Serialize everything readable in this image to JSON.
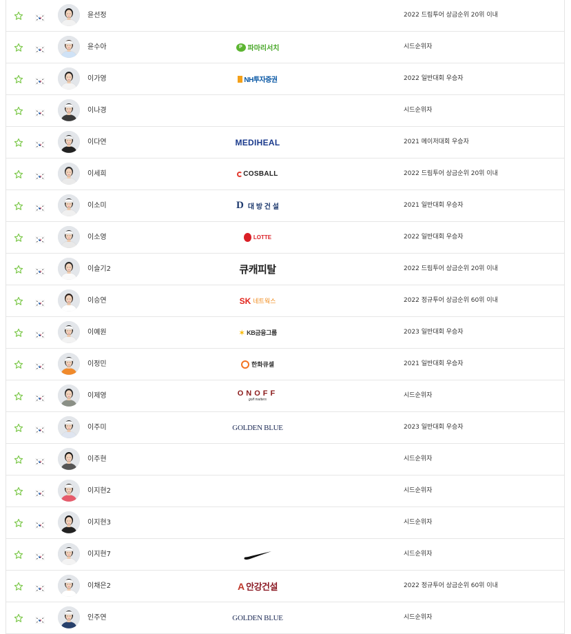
{
  "colors": {
    "star_outline": "#7cc84a",
    "border": "#e6e6e6",
    "text": "#333333"
  },
  "players": [
    {
      "name": "윤선정",
      "sponsor": null,
      "qualification": "2022 드림투어 상금순위 20위 이내"
    },
    {
      "name": "윤수아",
      "sponsor": {
        "kind": "pamarisc",
        "text": "파마리서치"
      },
      "qualification": "시드순위자"
    },
    {
      "name": "이가영",
      "sponsor": {
        "kind": "nh",
        "text": "NH투자증권"
      },
      "qualification": "2022 일반대회 우승자"
    },
    {
      "name": "이나경",
      "sponsor": null,
      "qualification": "시드순위자"
    },
    {
      "name": "이다연",
      "sponsor": {
        "kind": "mediheal",
        "text": "MEDIHEAL"
      },
      "qualification": "2021 메이저대회 우승자"
    },
    {
      "name": "이세희",
      "sponsor": {
        "kind": "cosball",
        "text": "COSBALL"
      },
      "qualification": "2022 드림투어 상금순위 20위 이내"
    },
    {
      "name": "이소미",
      "sponsor": {
        "kind": "daebang",
        "text": "대 방 건 설"
      },
      "qualification": "2021 일반대회 우승자"
    },
    {
      "name": "이소영",
      "sponsor": {
        "kind": "lotte",
        "text": "LOTTE"
      },
      "qualification": "2022 일반대회 우승자"
    },
    {
      "name": "이슬기2",
      "sponsor": {
        "kind": "qcap",
        "text": "큐캐피탈"
      },
      "qualification": "2022 드림투어 상금순위 20위 이내"
    },
    {
      "name": "이승연",
      "sponsor": {
        "kind": "sk",
        "text": "SK",
        "sub": "네트웍스"
      },
      "qualification": "2022 정규투어 상금순위 60위 이내"
    },
    {
      "name": "이예원",
      "sponsor": {
        "kind": "kb",
        "text": "KB금융그룹"
      },
      "qualification": "2023 일반대회 우승자"
    },
    {
      "name": "이정민",
      "sponsor": {
        "kind": "hanwha",
        "text": "한화큐셀"
      },
      "qualification": "2021 일반대회 우승자"
    },
    {
      "name": "이제영",
      "sponsor": {
        "kind": "onoff",
        "text": "ONOFF",
        "sub": "golf matters"
      },
      "qualification": "시드순위자"
    },
    {
      "name": "이주미",
      "sponsor": {
        "kind": "goldenblue",
        "text": "GOLDEN BLUE"
      },
      "qualification": "2023 일반대회 우승자"
    },
    {
      "name": "이주현",
      "sponsor": null,
      "qualification": "시드순위자"
    },
    {
      "name": "이지현2",
      "sponsor": null,
      "qualification": "시드순위자"
    },
    {
      "name": "이지현3",
      "sponsor": null,
      "qualification": "시드순위자"
    },
    {
      "name": "이지현7",
      "sponsor": {
        "kind": "nike",
        "text": ""
      },
      "qualification": "시드순위자"
    },
    {
      "name": "이채은2",
      "sponsor": {
        "kind": "angang",
        "text": "안강건설"
      },
      "qualification": "2022 정규투어 상금순위 60위 이내"
    },
    {
      "name": "인주연",
      "sponsor": {
        "kind": "goldenblue",
        "text": "GOLDEN BLUE"
      },
      "qualification": "시드순위자"
    }
  ]
}
